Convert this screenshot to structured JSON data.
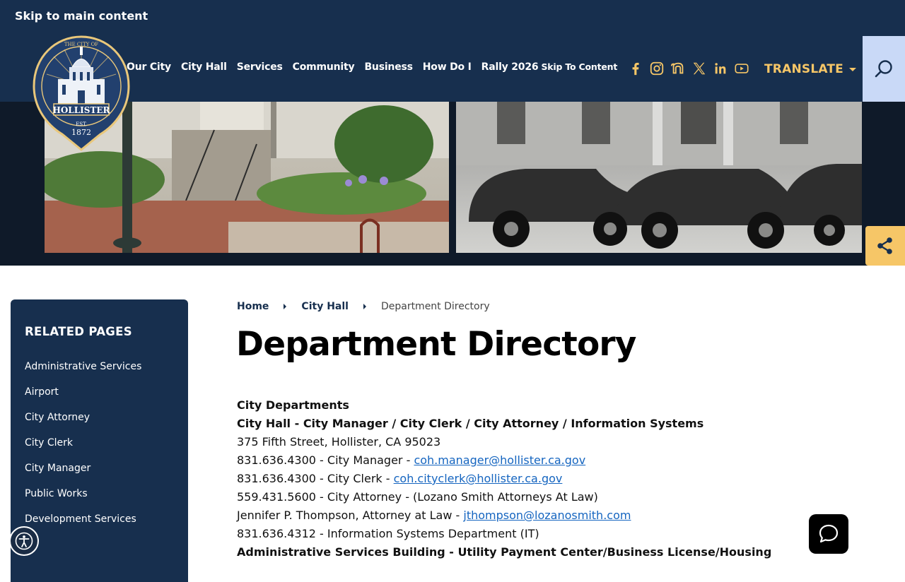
{
  "header": {
    "skip_link": "Skip to main content",
    "nav": [
      "Our City",
      "City Hall",
      "Services",
      "Community",
      "Business",
      "How Do I",
      "Rally 2026"
    ],
    "nav_skip": "Skip To Content",
    "social": [
      "facebook-icon",
      "instagram-icon",
      "nextdoor-icon",
      "x-icon",
      "linkedin-icon",
      "youtube-icon"
    ],
    "translate": "TRANSLATE",
    "logo_text": {
      "top": "THE CITY OF",
      "name": "HOLLISTER",
      "est": "EST.",
      "year": "1872"
    }
  },
  "colors": {
    "navy": "#172f4e",
    "gold": "#f6c667",
    "search_bg": "#c9d9f7",
    "link": "#1565c0"
  },
  "sidebar": {
    "title": "RELATED PAGES",
    "items": [
      "Administrative Services",
      "Airport",
      "City Attorney",
      "City Clerk",
      "City Manager",
      "Public Works",
      "Development Services"
    ]
  },
  "breadcrumb": {
    "home": "Home",
    "parent": "City Hall",
    "current": "Department Directory"
  },
  "page_title": "Department Directory",
  "content": {
    "section_heading": "City Departments",
    "city_hall_heading": "City Hall - City Manager / City Clerk / City Attorney / Information Systems",
    "address": "375 Fifth Street, Hollister, CA 95023",
    "manager_text": "831.636.4300 - City Manager - ",
    "manager_email": "coh.manager@hollister.ca.gov",
    "clerk_text": "831.636.4300 - City Clerk - ",
    "clerk_email": "coh.cityclerk@hollister.ca.gov",
    "attorney_line": "559.431.5600 - City Attorney - (Lozano Smith Attorneys At Law)",
    "thompson_text": "Jennifer P. Thompson, Attorney at Law - ",
    "thompson_email": "jthompson@lozanosmith.com",
    "it_line": "831.636.4312 - Information Systems Department (IT)",
    "admin_heading": "Administrative Services Building - Utility Payment Center/Business License/Housing"
  }
}
